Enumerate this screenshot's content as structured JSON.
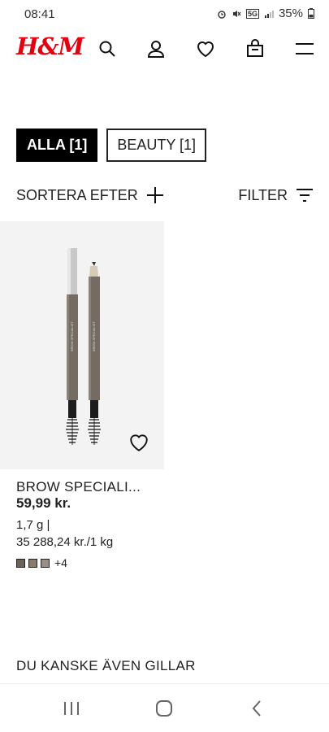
{
  "status_bar": {
    "time": "08:41",
    "battery": "35%",
    "icons": [
      "alarm-icon",
      "mute-icon",
      "5g-icon",
      "signal-icon",
      "battery-icon"
    ],
    "network": "5G"
  },
  "header": {
    "logo": "H&M",
    "logo_color": "#e50010",
    "icons": [
      "search-icon",
      "account-icon",
      "heart-icon",
      "bag-icon",
      "menu-icon"
    ]
  },
  "filters": {
    "chips": [
      {
        "label": "ALLA [1]",
        "active": true
      },
      {
        "label": "BEAUTY [1]",
        "active": false
      }
    ],
    "sort_label": "SORTERA EFTER",
    "filter_label": "FILTER"
  },
  "product": {
    "name": "BROW SPECIALI...",
    "price": "59,99 kr.",
    "size": "1,7 g |",
    "unit_price": "35 288,24 kr./1 kg",
    "swatch_colors": [
      "#6b6258",
      "#8a7d70",
      "#9a8f84"
    ],
    "more_colors": "+4",
    "pencil_imprint": "BROW SPECIALIST"
  },
  "recommendations": {
    "title": "DU KANSKE ÄVEN GILLAR"
  },
  "nav": {
    "icons": [
      "recents-icon",
      "home-icon",
      "back-icon"
    ]
  }
}
